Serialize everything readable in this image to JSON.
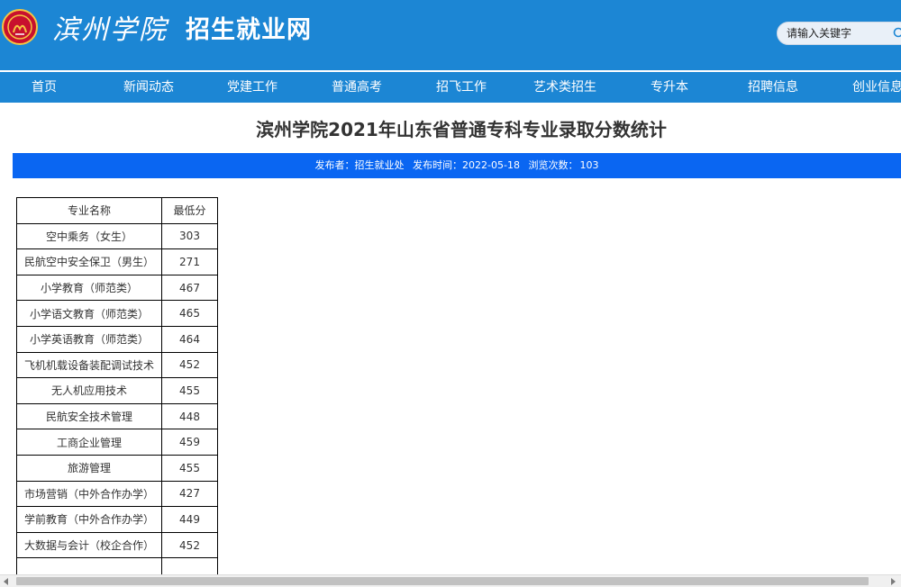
{
  "header": {
    "calligraphy": "滨州学院",
    "site_name": "招生就业网",
    "search_placeholder": "请输入关键字",
    "brand_color": "#1c86d4",
    "logo_icon": "university-seal-icon"
  },
  "nav": {
    "items": [
      {
        "label": "首页"
      },
      {
        "label": "新闻动态"
      },
      {
        "label": "党建工作"
      },
      {
        "label": "普通高考"
      },
      {
        "label": "招飞工作"
      },
      {
        "label": "艺术类招生"
      },
      {
        "label": "专升本"
      },
      {
        "label": "招聘信息"
      },
      {
        "label": "创业信息"
      }
    ]
  },
  "article": {
    "title": "滨州学院2021年山东省普通专科专业录取分数统计",
    "meta": {
      "publisher_label": "发布者：",
      "publisher": "招生就业处",
      "time_label": "发布时间：",
      "time": "2022-05-18",
      "views_label": "浏览次数：",
      "views": "103"
    },
    "meta_bar_color": "#0a66f2"
  },
  "table": {
    "headers": [
      "专业名称",
      "最低分"
    ],
    "rows": [
      [
        "空中乘务（女生）",
        "303"
      ],
      [
        "民航空中安全保卫（男生）",
        "271"
      ],
      [
        "小学教育（师范类）",
        "467"
      ],
      [
        "小学语文教育（师范类）",
        "465"
      ],
      [
        "小学英语教育（师范类）",
        "464"
      ],
      [
        "飞机机载设备装配调试技术",
        "452"
      ],
      [
        "无人机应用技术",
        "455"
      ],
      [
        "民航安全技术管理",
        "448"
      ],
      [
        "工商企业管理",
        "459"
      ],
      [
        "旅游管理",
        "455"
      ],
      [
        "市场营销（中外合作办学）",
        "427"
      ],
      [
        "学前教育（中外合作办学）",
        "449"
      ],
      [
        "大数据与会计（校企合作）",
        "452"
      ]
    ]
  }
}
